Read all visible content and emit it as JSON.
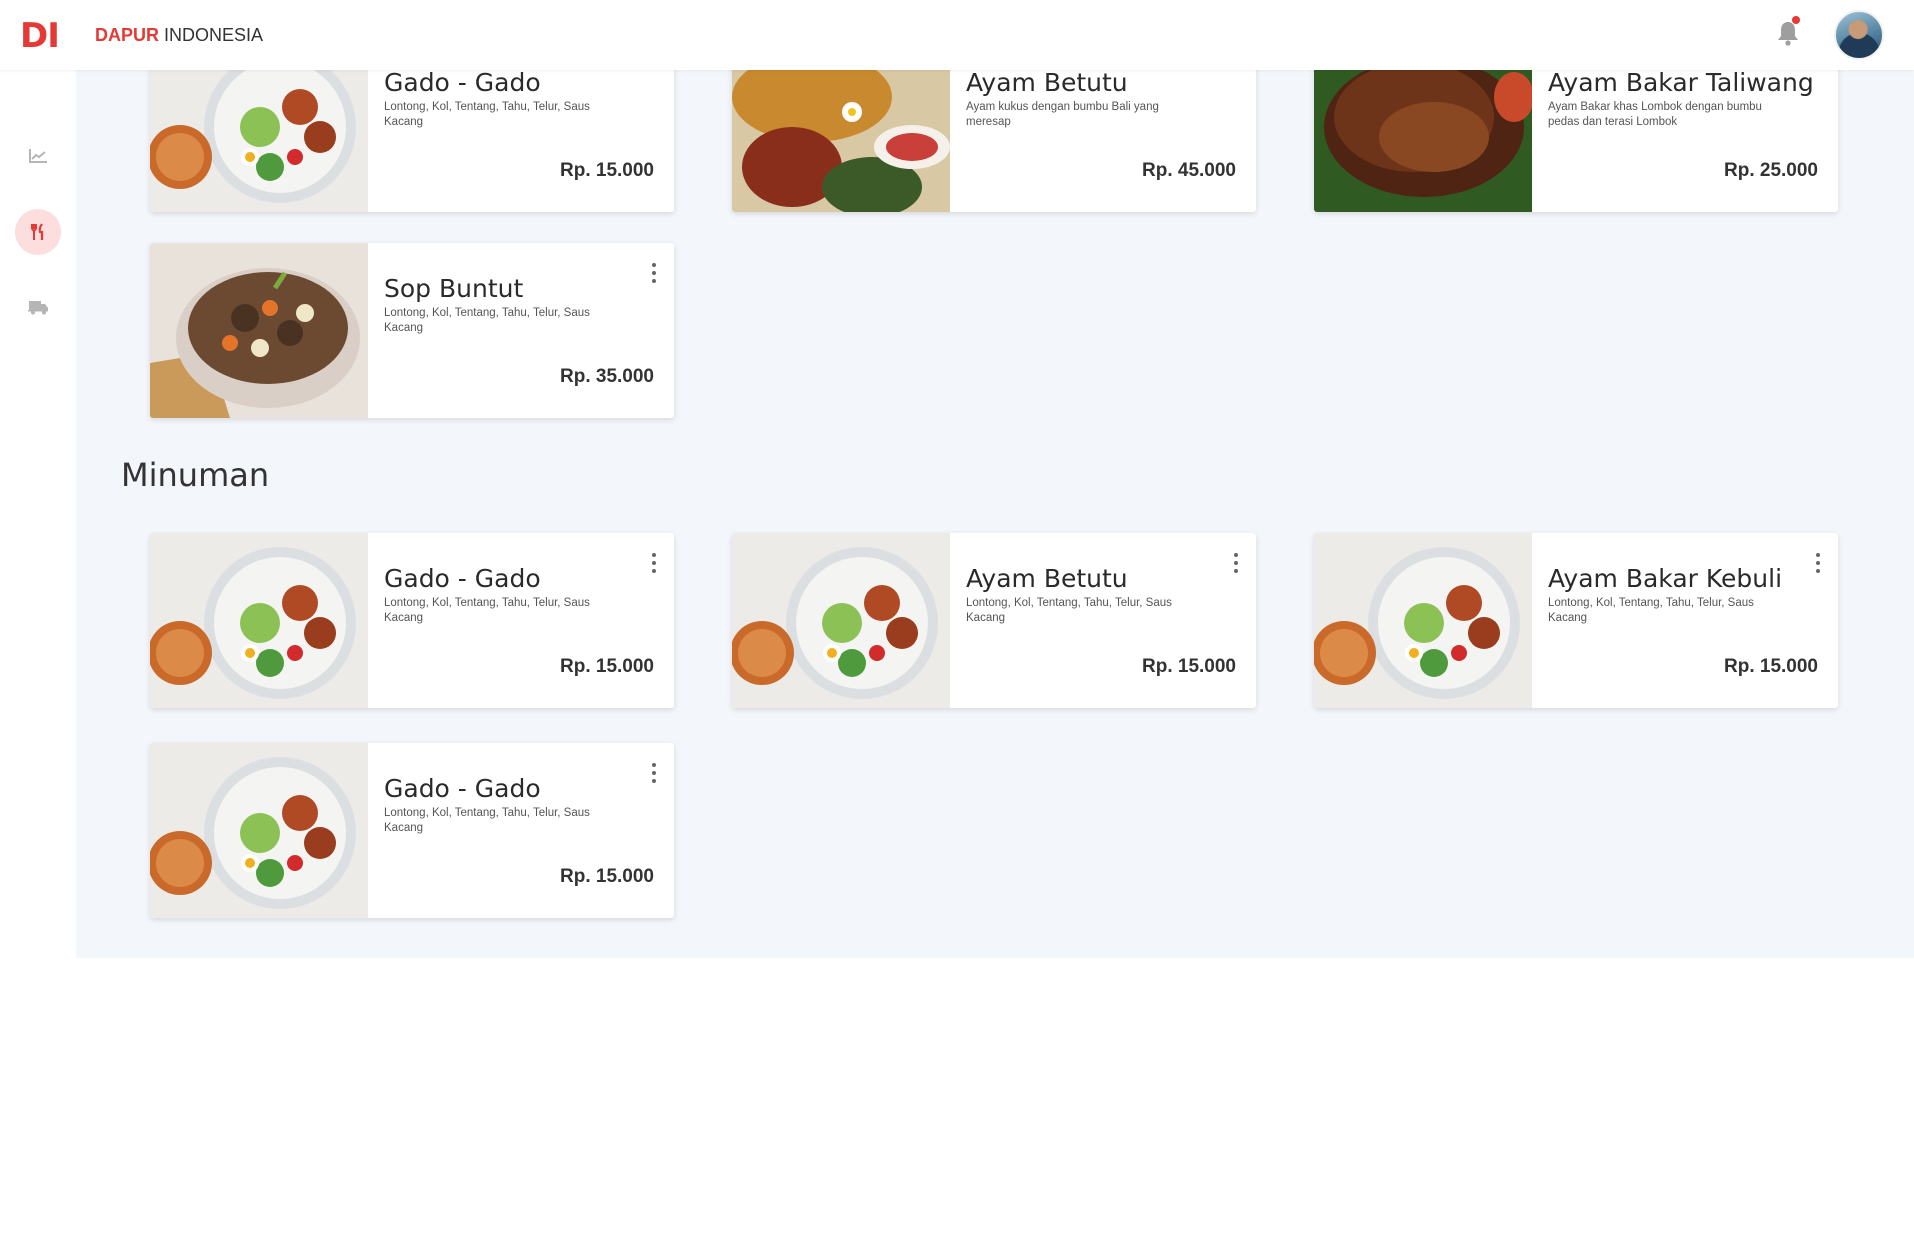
{
  "app": {
    "logo_text": "DI",
    "brand_strong": "DAPUR",
    "brand_rest": " INDONESIA",
    "accent_color": "#e53935"
  },
  "header": {
    "notification_icon": "bell-icon",
    "has_unread_notification": true,
    "avatar": "user-avatar"
  },
  "sidebar": {
    "items": [
      {
        "icon": "chart-line-icon",
        "active": false
      },
      {
        "icon": "fork-knife-icon",
        "active": true
      },
      {
        "icon": "delivery-truck-icon",
        "active": false
      }
    ]
  },
  "top_row": [
    {
      "title": "Gado - Gado",
      "desc": "Lontong, Kol, Tentang, Tahu, Telur, Saus Kacang",
      "price": "Rp. 15.000",
      "photo": "gado"
    },
    {
      "title": "Ayam Betutu",
      "desc": "Ayam kukus dengan bumbu Bali yang meresap",
      "price": "Rp. 45.000",
      "photo": "betutu"
    },
    {
      "title": "Ayam Bakar Taliwang",
      "desc": "Ayam Bakar khas Lombok dengan bumbu pedas dan terasi Lombok",
      "price": "Rp. 25.000",
      "photo": "taliwang"
    }
  ],
  "makanan_extra": [
    {
      "title": "Sop Buntut",
      "desc": "Lontong, Kol, Tentang, Tahu, Telur, Saus Kacang",
      "price": "Rp. 35.000",
      "photo": "sop"
    }
  ],
  "sections": {
    "minuman_title": "Minuman"
  },
  "minuman": [
    {
      "title": "Gado - Gado",
      "desc": "Lontong, Kol, Tentang, Tahu, Telur, Saus Kacang",
      "price": "Rp. 15.000",
      "photo": "gado"
    },
    {
      "title": "Ayam Betutu",
      "desc": "Lontong, Kol, Tentang, Tahu, Telur, Saus Kacang",
      "price": "Rp. 15.000",
      "photo": "gado"
    },
    {
      "title": "Ayam Bakar Kebuli",
      "desc": "Lontong, Kol, Tentang, Tahu, Telur, Saus Kacang",
      "price": "Rp. 15.000",
      "photo": "gado"
    },
    {
      "title": "Gado - Gado",
      "desc": "Lontong, Kol, Tentang, Tahu, Telur, Saus Kacang",
      "price": "Rp. 15.000",
      "photo": "gado"
    }
  ]
}
